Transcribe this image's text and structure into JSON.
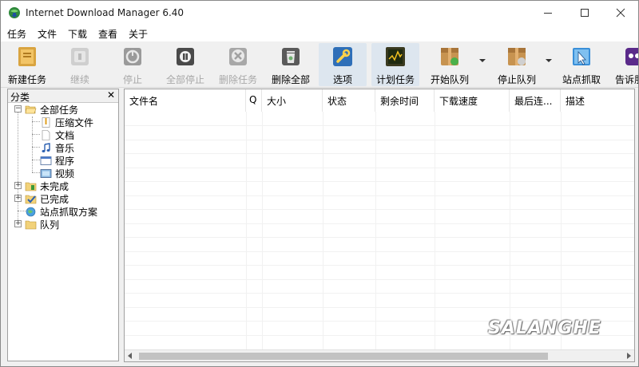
{
  "window": {
    "title": "Internet Download Manager 6.40"
  },
  "menu": [
    "任务",
    "文件",
    "下载",
    "查看",
    "关于"
  ],
  "toolbar": {
    "new_task": "新建任务",
    "resume": "继续",
    "stop": "停止",
    "stop_all": "全部停止",
    "delete_task": "删除任务",
    "delete_all": "删除全部",
    "options": "选项",
    "scheduler": "计划任务",
    "start_queue": "开始队列",
    "stop_queue": "停止队列",
    "site_grabber": "站点抓取",
    "tell_friend": "告诉朋友"
  },
  "categories": {
    "title": "分类",
    "close": "✕",
    "all": "全部任务",
    "compressed": "压缩文件",
    "documents": "文档",
    "music": "音乐",
    "programs": "程序",
    "video": "视频",
    "unfinished": "未完成",
    "finished": "已完成",
    "grabber_projects": "站点抓取方案",
    "queues": "队列"
  },
  "columns": [
    "文件名",
    "Q",
    "大小",
    "状态",
    "剩余时间",
    "下载速度",
    "最后连...",
    "描述"
  ],
  "watermark": "SALANGHE",
  "colors": {
    "accent": "#2e72c4",
    "toolbar_bg": "#f0f0f0",
    "selection": "#dde6ef"
  }
}
